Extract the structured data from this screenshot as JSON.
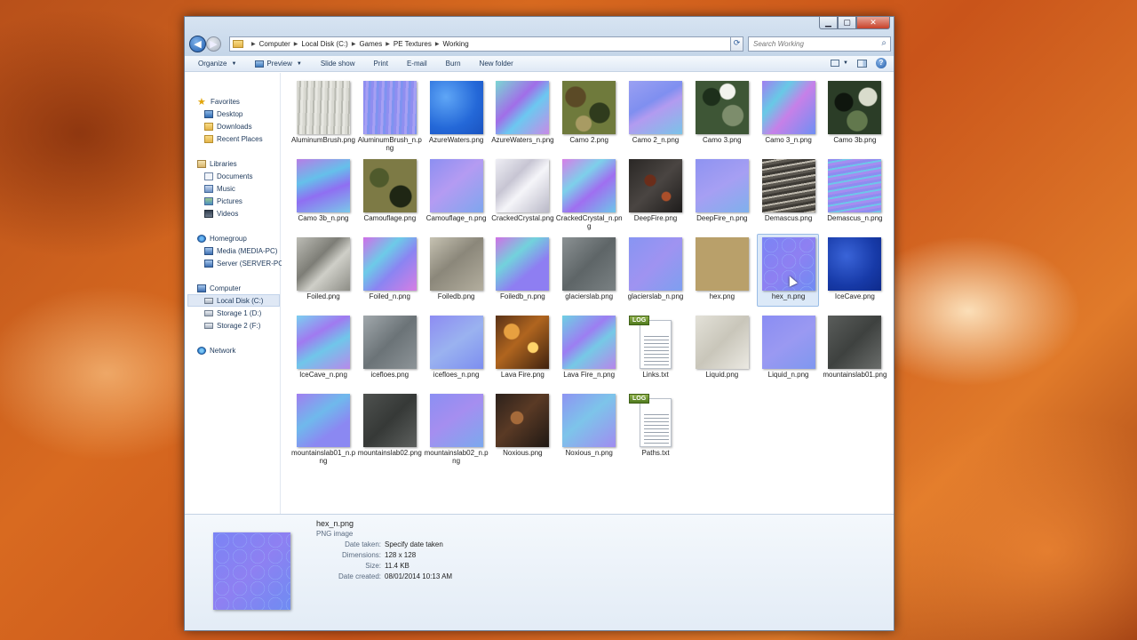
{
  "window": {
    "controls": {
      "minimize": "▁",
      "maximize": "▢",
      "close": "✕"
    }
  },
  "address_bar": {
    "crumbs": [
      "Computer",
      "Local Disk (C:)",
      "Games",
      "PE Textures",
      "Working"
    ],
    "search_placeholder": "Search Working"
  },
  "toolbar": {
    "organize": "Organize",
    "preview": "Preview",
    "slideshow": "Slide show",
    "print": "Print",
    "email": "E-mail",
    "burn": "Burn",
    "new_folder": "New folder"
  },
  "nav": {
    "favorites": "Favorites",
    "desktop": "Desktop",
    "downloads": "Downloads",
    "recent": "Recent Places",
    "libraries": "Libraries",
    "documents": "Documents",
    "music": "Music",
    "pictures": "Pictures",
    "videos": "Videos",
    "homegroup": "Homegroup",
    "media": "Media (MEDIA-PC)",
    "server": "Server (SERVER-PC)",
    "computer": "Computer",
    "local_disk": "Local Disk (C:)",
    "storage1": "Storage 1 (D:)",
    "storage2": "Storage 2 (F:)",
    "network": "Network"
  },
  "files": [
    {
      "name": "AluminumBrush.png",
      "tex": "alu"
    },
    {
      "name": "AluminumBrush_n.png",
      "tex": "alun"
    },
    {
      "name": "AzureWaters.png",
      "tex": "azure"
    },
    {
      "name": "AzureWaters_n.png",
      "tex": "azuren"
    },
    {
      "name": "Camo 2.png",
      "tex": "camo"
    },
    {
      "name": "Camo 2_n.png",
      "tex": "camo2n"
    },
    {
      "name": "Camo 3.png",
      "tex": "camo3"
    },
    {
      "name": "Camo 3_n.png",
      "tex": "camo3n"
    },
    {
      "name": "Camo 3b.png",
      "tex": "camo3b"
    },
    {
      "name": "Camo 3b_n.png",
      "tex": "camo3bn"
    },
    {
      "name": "Camouflage.png",
      "tex": "camouf"
    },
    {
      "name": "Camouflage_n.png",
      "tex": "camoufn"
    },
    {
      "name": "CrackedCrystal.png",
      "tex": "crack"
    },
    {
      "name": "CrackedCrystal_n.png",
      "tex": "crackn"
    },
    {
      "name": "DeepFire.png",
      "tex": "deepfire"
    },
    {
      "name": "DeepFire_n.png",
      "tex": "deepfiren"
    },
    {
      "name": "Demascus.png",
      "tex": "dema"
    },
    {
      "name": "Demascus_n.png",
      "tex": "deman"
    },
    {
      "name": "Foiled.png",
      "tex": "foiled"
    },
    {
      "name": "Foiled_n.png",
      "tex": "foiledn"
    },
    {
      "name": "Foiledb.png",
      "tex": "foiledb"
    },
    {
      "name": "Foiledb_n.png",
      "tex": "foiledbn"
    },
    {
      "name": "glacierslab.png",
      "tex": "glacier"
    },
    {
      "name": "glacierslab_n.png",
      "tex": "glaciern"
    },
    {
      "name": "hex.png",
      "tex": "hex"
    },
    {
      "name": "hex_n.png",
      "tex": "hexn",
      "selected": true
    },
    {
      "name": "IceCave.png",
      "tex": "icecave"
    },
    {
      "name": "IceCave_n.png",
      "tex": "icecaven"
    },
    {
      "name": "icefloes.png",
      "tex": "icefloes"
    },
    {
      "name": "icefloes_n.png",
      "tex": "icefloesn"
    },
    {
      "name": "Lava Fire.png",
      "tex": "lava"
    },
    {
      "name": "Lava Fire_n.png",
      "tex": "lavan"
    },
    {
      "name": "Links.txt",
      "tex": "txt"
    },
    {
      "name": "Liquid.png",
      "tex": "liquid"
    },
    {
      "name": "Liquid_n.png",
      "tex": "liquidn"
    },
    {
      "name": "mountainslab01.png",
      "tex": "mountain"
    },
    {
      "name": "mountainslab01_n.png",
      "tex": "mountainn"
    },
    {
      "name": "mountainslab02.png",
      "tex": "mountain2"
    },
    {
      "name": "mountainslab02_n.png",
      "tex": "mountain2n"
    },
    {
      "name": "Noxious.png",
      "tex": "noxious"
    },
    {
      "name": "Noxious_n.png",
      "tex": "noxiousn"
    },
    {
      "name": "Paths.txt",
      "tex": "txt"
    }
  ],
  "txt_tag": "LOG",
  "details": {
    "name": "hex_n.png",
    "type": "PNG image",
    "rows": [
      {
        "label": "Date taken:",
        "value": "Specify date taken"
      },
      {
        "label": "Dimensions:",
        "value": "128 x 128"
      },
      {
        "label": "Size:",
        "value": "11.4 KB"
      },
      {
        "label": "Date created:",
        "value": "08/01/2014 10:13 AM"
      }
    ]
  }
}
